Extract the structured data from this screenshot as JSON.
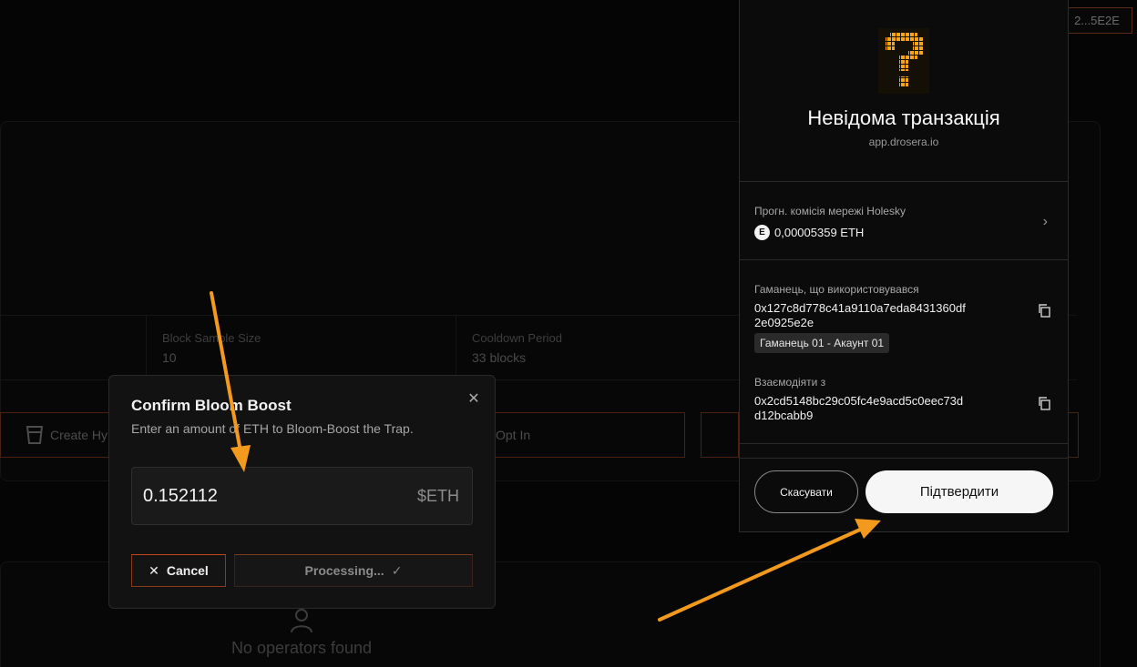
{
  "background": {
    "wallet_address": "2...5E2E",
    "stats": [
      {
        "label": "Block Sample Size",
        "value": "10"
      },
      {
        "label": "Cooldown Period",
        "value": "33 blocks"
      }
    ],
    "buttons": {
      "create": "Create Hy",
      "opt_in": "Opt In"
    },
    "empty_state": "No operators found"
  },
  "modal": {
    "title": "Confirm Bloom Boost",
    "subtitle": "Enter an amount of ETH to Bloom-Boost the Trap.",
    "amount": "0.152112",
    "unit": "$ETH",
    "cancel_label": "Cancel",
    "processing_label": "Processing..."
  },
  "wallet": {
    "title": "Невідома транзакція",
    "origin": "app.drosera.io",
    "fee_label": "Прогн. комісія мережі Holesky",
    "fee_badge": "E",
    "fee_value": "0,00005359 ETH",
    "used_wallet_label": "Гаманець, що використовувався",
    "used_wallet_line1": "0x127c8d778c41a9110a7eda8431360df",
    "used_wallet_line2": "2e0925e2e",
    "account_tag": "Гаманець 01 - Акаунт 01",
    "interact_label": "Взаємодіяти з",
    "interact_line1": "0x2cd5148bc29c05fc4e9acd5c0eec73d",
    "interact_line2": "d12bcabb9",
    "cancel_label": "Скасувати",
    "confirm_label": "Підтвердити"
  },
  "colors": {
    "accent": "#f7a41d",
    "arrow": "#f39a1e",
    "background": "#050505"
  }
}
